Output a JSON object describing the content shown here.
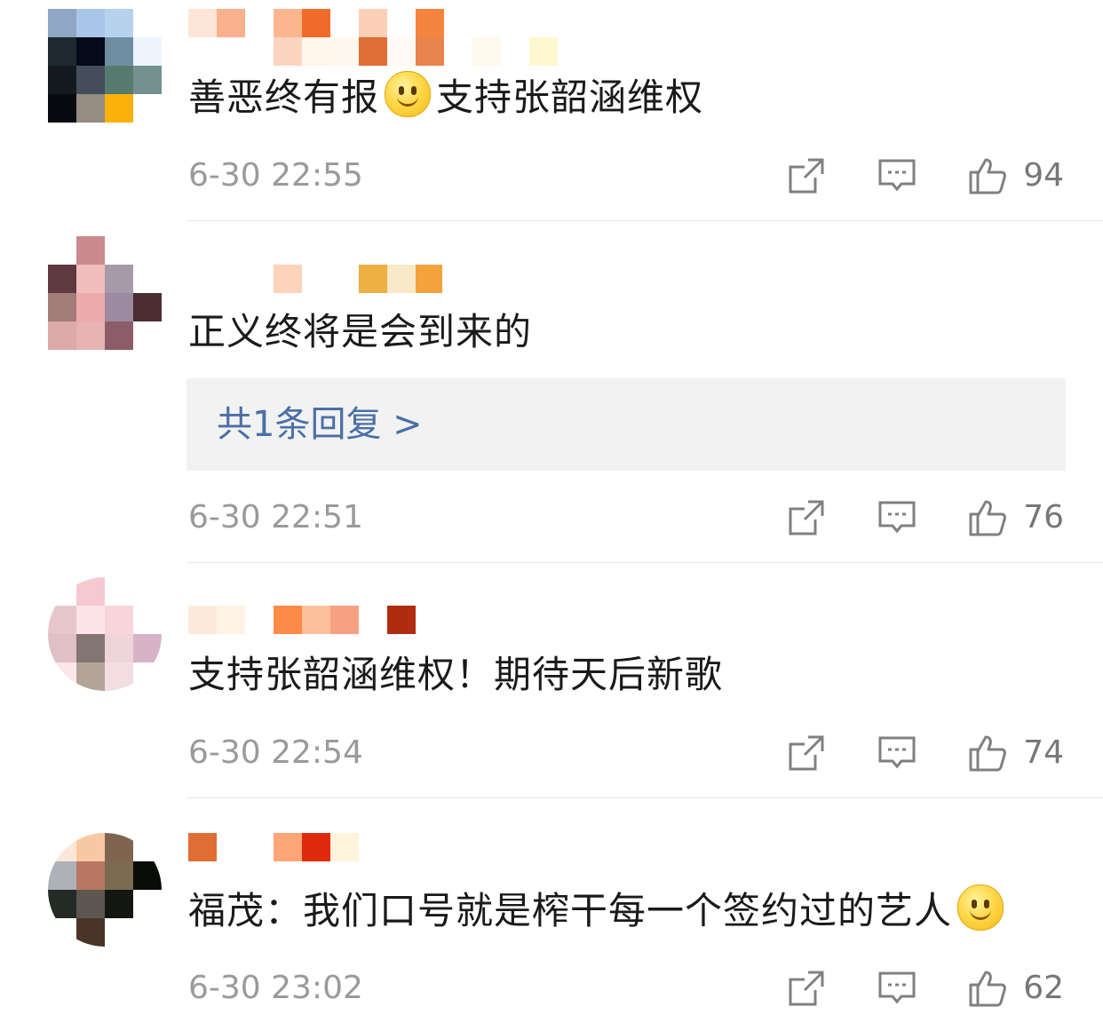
{
  "comments": [
    {
      "text_before": "善恶终有报",
      "emoji": "smile-emoji",
      "text_after": "支持张韶涵维权",
      "time": "6-30 22:55",
      "likes": "94"
    },
    {
      "text_before": "正义终将是会到来的",
      "time": "6-30 22:51",
      "likes": "76",
      "reply_label": "共1条回复 >"
    },
    {
      "text_before": "支持张韶涵维权！期待天后新歌",
      "time": "6-30 22:54",
      "likes": "74"
    },
    {
      "text_before": "福茂：我们口号就是榨干每一个签约过的艺人",
      "emoji": "smile-emoji",
      "time": "6-30 23:02",
      "likes": "62"
    }
  ],
  "icons": {
    "forward": "forward-icon",
    "comment": "comment-icon",
    "like": "like-icon"
  },
  "colors": {
    "reply_link": "#4a6fa5",
    "timestamp": "#9a9a9a",
    "text": "#1a1a1a"
  }
}
